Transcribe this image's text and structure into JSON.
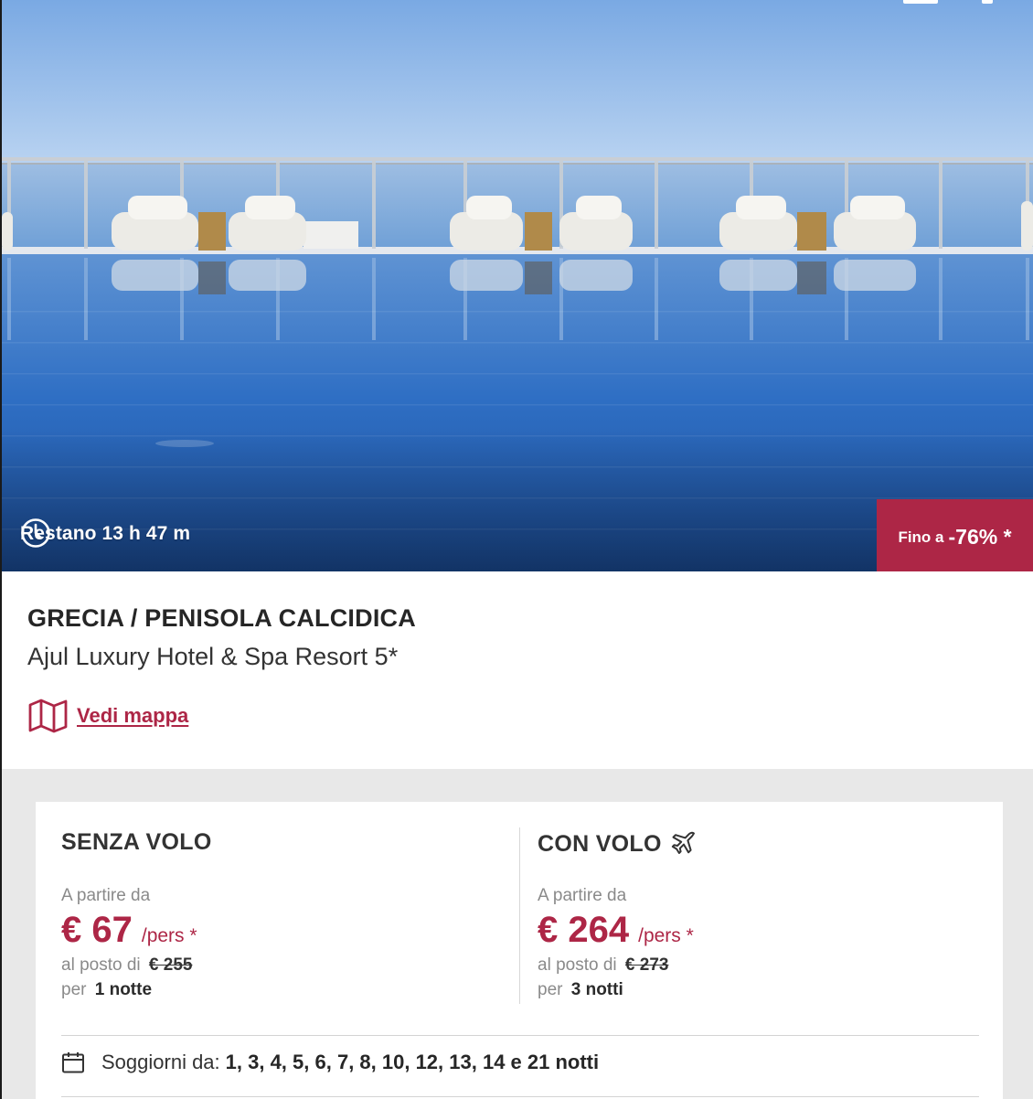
{
  "colors": {
    "accent": "#ad2646",
    "sky": "#86b4e8",
    "pool": "#2f6fc4",
    "pool_deep": "#1c4f9c",
    "rail": "#c9ced4",
    "cushion": "#ecebe6",
    "wood": "#b08a4a",
    "grey_bg": "#e8e8e8"
  },
  "hero": {
    "image_subject": "infinity-pool-with-sea-view",
    "timer": {
      "icon": "clock-icon",
      "text": "Restano 13 h 47 m"
    },
    "discount": {
      "prefix": "Fino a",
      "value": "-76% *"
    }
  },
  "offer": {
    "destination": "GRECIA / PENISOLA CALCIDICA",
    "hotel": "Ajul Luxury Hotel & Spa Resort 5*",
    "map": {
      "icon": "map-icon",
      "label": "Vedi mappa"
    }
  },
  "prices": {
    "without_flight": {
      "title": "SENZA VOLO",
      "from_label": "A partire da",
      "price": "€ 67",
      "per": "/pers *",
      "instead_label": "al posto di",
      "old_price": "€ 255",
      "for_label": "per",
      "nights": "1 notte"
    },
    "with_flight": {
      "title": "CON VOLO",
      "icon": "airplane-icon",
      "from_label": "A partire da",
      "price": "€ 264",
      "per": "/pers *",
      "instead_label": "al posto di",
      "old_price": "€ 273",
      "for_label": "per",
      "nights": "3 notti"
    }
  },
  "stays": {
    "icon": "calendar-icon",
    "label": "Soggiorni da:",
    "values": "1, 3, 4, 5, 6, 7, 8, 10, 12, 13, 14 e 21 notti"
  }
}
